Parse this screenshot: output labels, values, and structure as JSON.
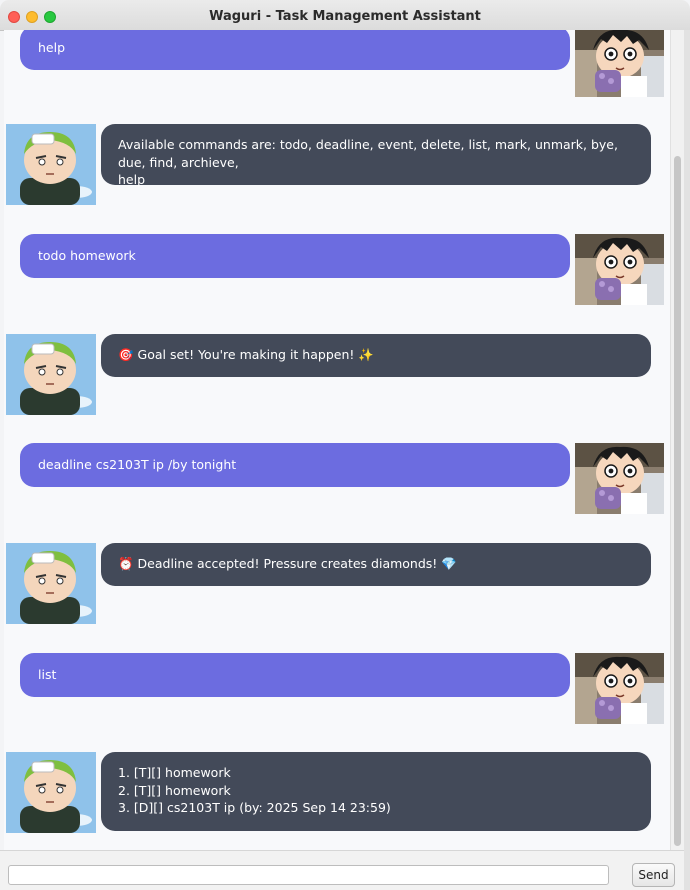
{
  "window": {
    "title": "Waguri - Task Management Assistant"
  },
  "colors": {
    "user_bubble": "#6c6ce0",
    "bot_bubble": "#434a59",
    "chat_bg": "#f8f9fb"
  },
  "icons": {
    "user_avatar": "luffy-character-avatar",
    "bot_avatar": "zoro-character-avatar",
    "goal_emoji": "dart-target-icon",
    "goal_sparkle": "sparkles-icon",
    "deadline_emoji": "alarm-clock-icon",
    "diamond_emoji": "gem-icon"
  },
  "messages": [
    {
      "sender": "user",
      "lines": [
        "help"
      ]
    },
    {
      "sender": "bot",
      "lines": [
        "Available commands are: todo, deadline, event, delete, list, mark, unmark, bye, due, find, archieve,",
        "help"
      ]
    },
    {
      "sender": "user",
      "lines": [
        "todo homework"
      ]
    },
    {
      "sender": "bot",
      "lines": [
        "🎯 Goal set! You're making it happen! ✨"
      ]
    },
    {
      "sender": "user",
      "lines": [
        "deadline cs2103T ip /by tonight"
      ]
    },
    {
      "sender": "bot",
      "lines": [
        "⏰ Deadline accepted! Pressure creates diamonds! 💎"
      ]
    },
    {
      "sender": "user",
      "lines": [
        "list"
      ]
    },
    {
      "sender": "bot",
      "lines": [
        "1. [T][] homework",
        "2. [T][] homework",
        "3. [D][] cs2103T ip (by: 2025 Sep 14 23:59)"
      ]
    }
  ],
  "input": {
    "value": "",
    "placeholder": ""
  },
  "send_button": {
    "label": "Send"
  }
}
